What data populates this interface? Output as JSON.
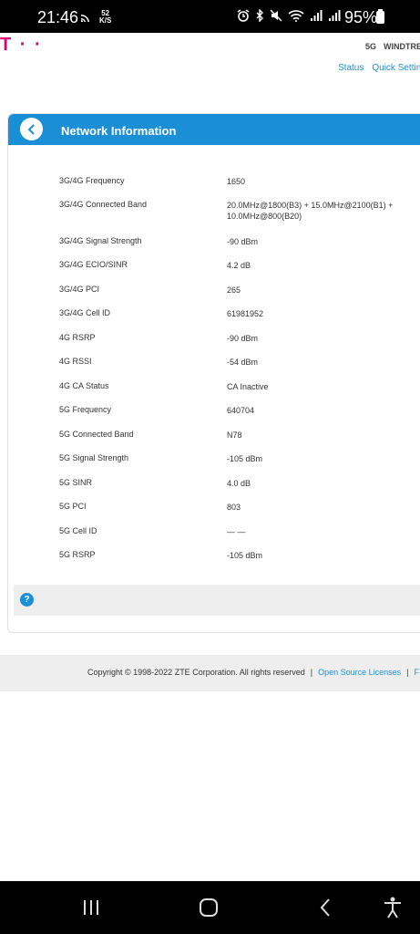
{
  "status_bar": {
    "time": "21:46",
    "speed_value": "52",
    "speed_unit": "K/S",
    "battery": "95%"
  },
  "header": {
    "logo": "T · ·",
    "network_label": "5G",
    "operator": "WINDTRE",
    "links": [
      "Status",
      "Quick Setting"
    ]
  },
  "network_info": {
    "title": "Network Information",
    "rows": [
      {
        "label": "3G/4G Frequency",
        "value": "1650"
      },
      {
        "label": "3G/4G Connected Band",
        "value": "20.0MHz@1800(B3) + 15.0MHz@2100(B1) + 10.0MHz@800(B20)"
      },
      {
        "label": "3G/4G Signal Strength",
        "value": "-90 dBm"
      },
      {
        "label": "3G/4G ECIO/SINR",
        "value": "4.2 dB"
      },
      {
        "label": "3G/4G PCI",
        "value": "265"
      },
      {
        "label": "3G/4G Cell ID",
        "value": "61981952"
      },
      {
        "label": "4G RSRP",
        "value": "-90 dBm"
      },
      {
        "label": "4G RSSI",
        "value": "-54 dBm"
      },
      {
        "label": "4G CA Status",
        "value": "CA Inactive"
      },
      {
        "label": "5G Frequency",
        "value": "640704"
      },
      {
        "label": "5G Connected Band",
        "value": "N78"
      },
      {
        "label": "5G Signal Strength",
        "value": "-105 dBm"
      },
      {
        "label": "5G SINR",
        "value": "4.0 dB"
      },
      {
        "label": "5G PCI",
        "value": "803"
      },
      {
        "label": "5G Cell ID",
        "value": "— —"
      },
      {
        "label": "5G RSRP",
        "value": "-105 dBm"
      }
    ],
    "help_icon": "?"
  },
  "footer": {
    "copyright": "Copyright © 1998-2022 ZTE Corporation. All rights reserved",
    "separator": "|",
    "open_source": "Open Source Licenses",
    "next_link": "F"
  },
  "colors": {
    "accent": "#1b8fd6",
    "brand": "#e20074",
    "link": "#1f8fd4"
  }
}
